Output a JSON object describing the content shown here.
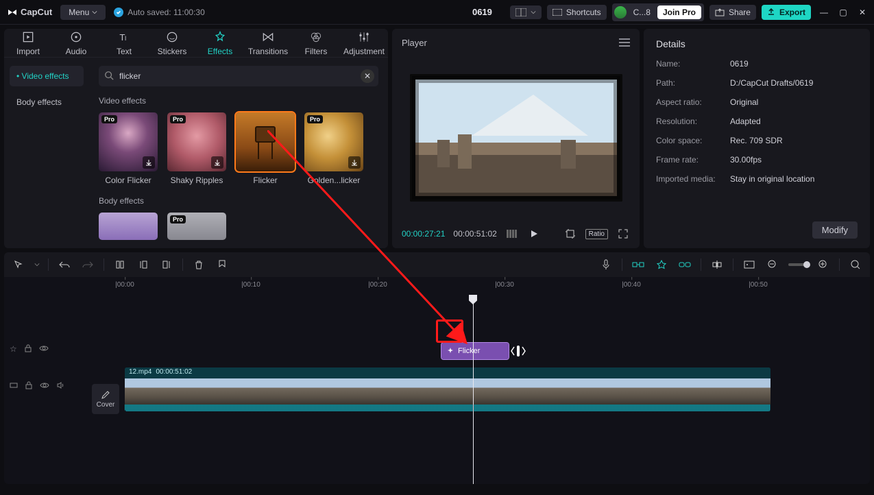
{
  "titlebar": {
    "app_name": "CapCut",
    "menu_label": "Menu",
    "autosave": "Auto saved: 11:00:30",
    "project_name": "0619",
    "shortcuts_label": "Shortcuts",
    "cloud_label": "C...8",
    "join_pro": "Join Pro",
    "share_label": "Share",
    "export_label": "Export"
  },
  "topnav": {
    "import": "Import",
    "audio": "Audio",
    "text": "Text",
    "stickers": "Stickers",
    "effects": "Effects",
    "transitions": "Transitions",
    "filters": "Filters",
    "adjustment": "Adjustment"
  },
  "subnav": {
    "video_effects": "Video effects",
    "body_effects": "Body effects"
  },
  "search": {
    "value": "flicker"
  },
  "sections": {
    "video_effects_title": "Video effects",
    "body_effects_title": "Body effects",
    "items": [
      {
        "label": "Color Flicker",
        "pro": true
      },
      {
        "label": "Shaky Ripples",
        "pro": true
      },
      {
        "label": "Flicker",
        "pro": false
      },
      {
        "label": "Golden...licker",
        "pro": true
      }
    ]
  },
  "player": {
    "title": "Player",
    "current": "00:00:27:21",
    "duration": "00:00:51:02",
    "ratio_label": "Ratio"
  },
  "details": {
    "title": "Details",
    "rows": {
      "name_k": "Name:",
      "name_v": "0619",
      "path_k": "Path:",
      "path_v": "D:/CapCut Drafts/0619",
      "aspect_k": "Aspect ratio:",
      "aspect_v": "Original",
      "res_k": "Resolution:",
      "res_v": "Adapted",
      "cs_k": "Color space:",
      "cs_v": "Rec. 709 SDR",
      "fr_k": "Frame rate:",
      "fr_v": "30.00fps",
      "im_k": "Imported media:",
      "im_v": "Stay in original location"
    },
    "modify": "Modify"
  },
  "timeline": {
    "ticks": [
      "|00:00",
      "|00:10",
      "|00:20",
      "|00:30",
      "|00:40",
      "|00:50"
    ],
    "effect_clip_label": "Flicker",
    "video_clip_name": "12.mp4",
    "video_clip_dur": "00:00:51:02",
    "cover_label": "Cover"
  }
}
